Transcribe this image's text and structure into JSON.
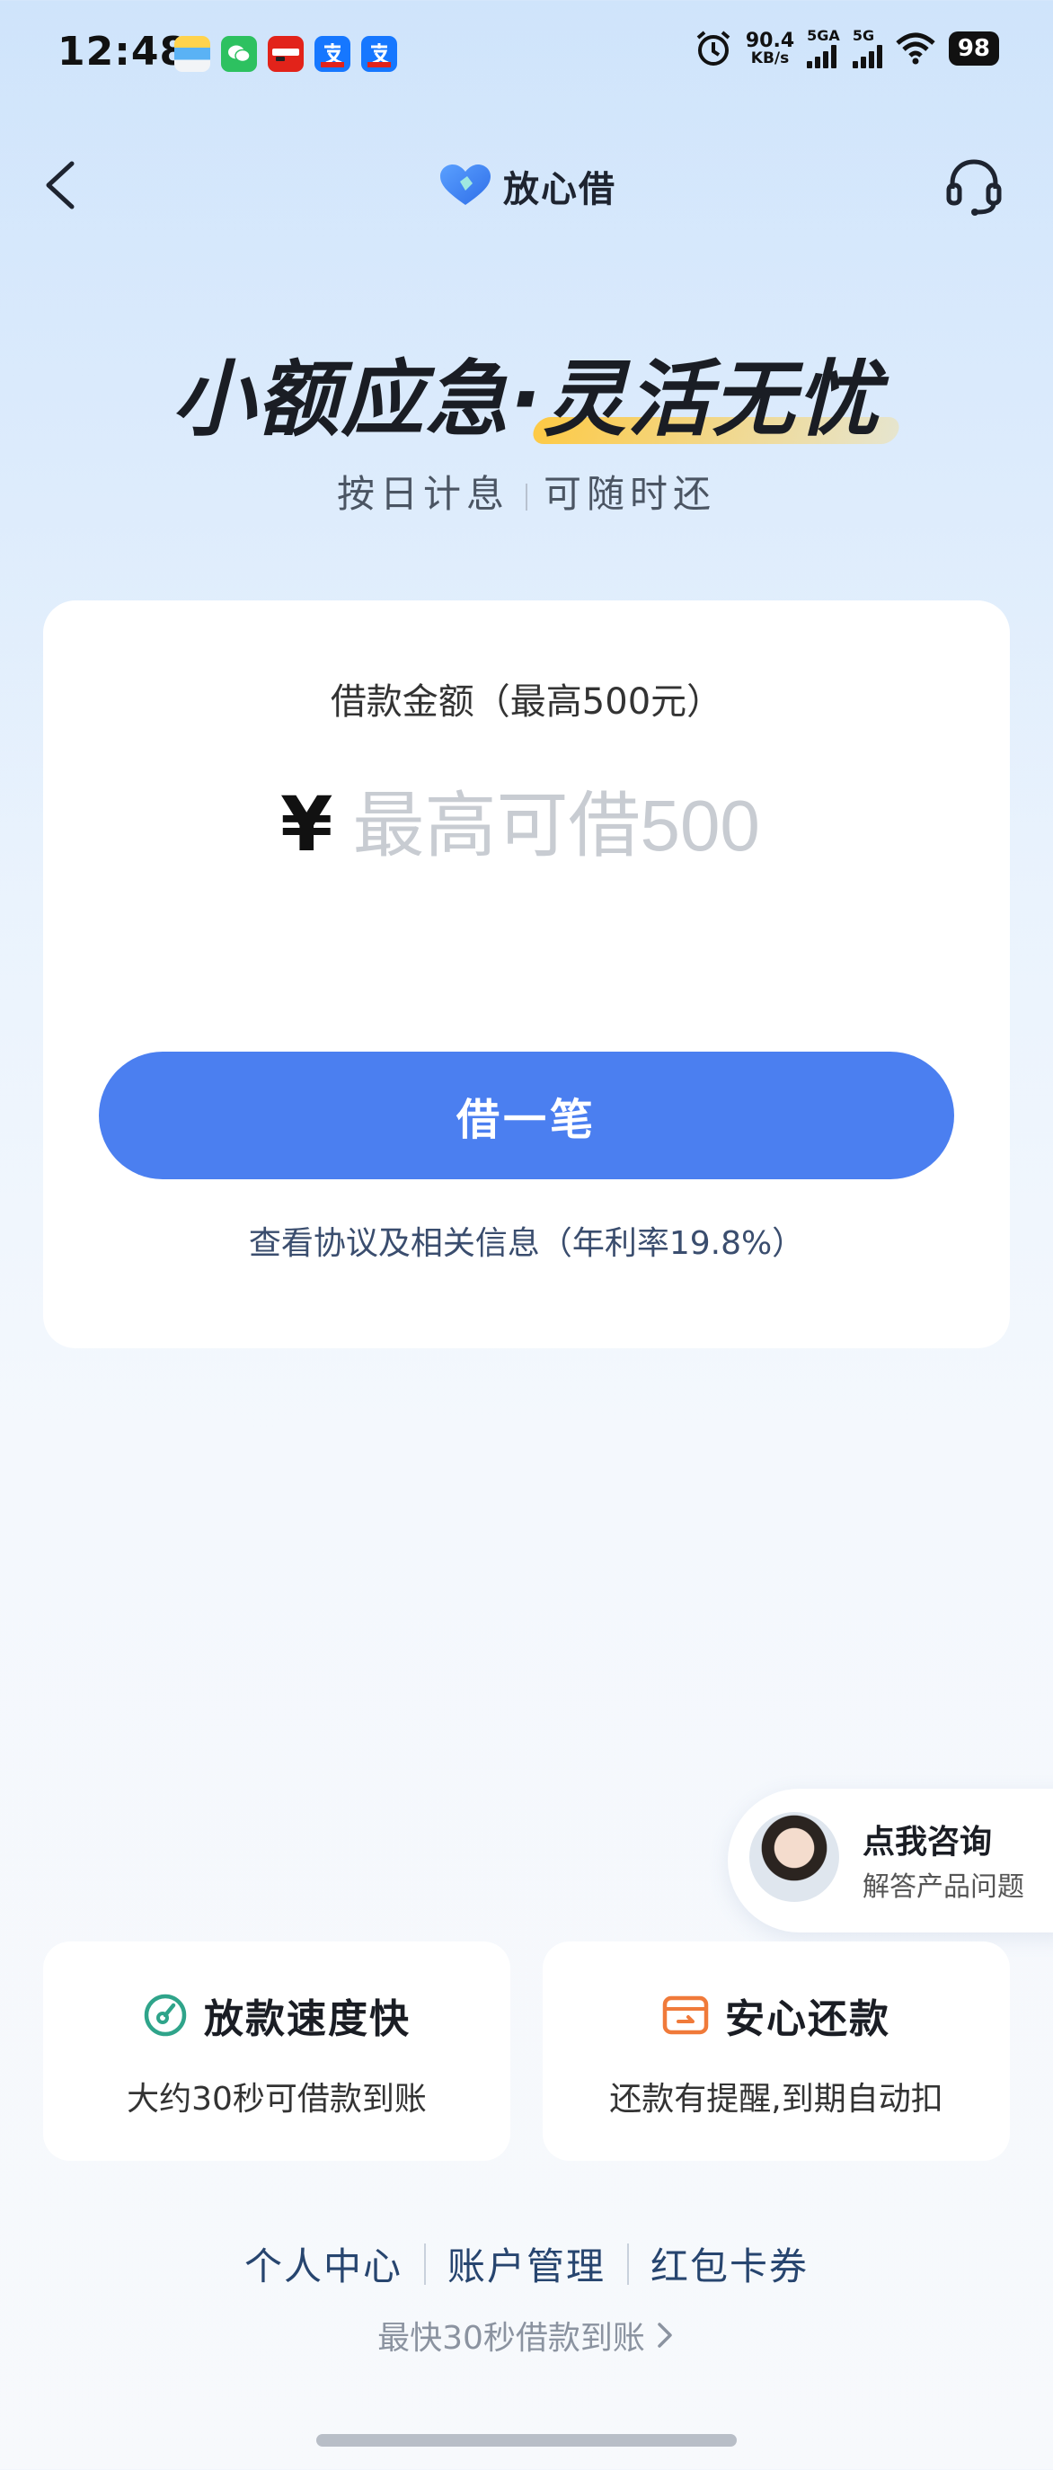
{
  "status_bar": {
    "time": "12:48",
    "net_speed_value": "90.4",
    "net_speed_unit": "KB/s",
    "sim1_label": "5GA",
    "sim2_label": "5G",
    "battery": "98",
    "app_icons": [
      "wallet-icon",
      "wechat-icon",
      "china-unionpay-icon",
      "alipay-icon",
      "alipay-icon"
    ]
  },
  "header": {
    "brand_name": "放心借",
    "back_icon": "chevron-left-icon",
    "service_icon": "headset-icon"
  },
  "hero": {
    "title_part1": "小额应急·",
    "title_part2": "灵活无忧",
    "subtitle_left": "按日计息",
    "subtitle_right": "可随时还"
  },
  "loan_card": {
    "amount_label": "借款金额（最高500元）",
    "currency_symbol": "¥",
    "amount_placeholder": "最高可借500",
    "borrow_button": "借一笔",
    "agreement_text": "查看协议及相关信息（年利率19.8%）"
  },
  "consult": {
    "title": "点我咨询",
    "subtitle": "解答产品问题"
  },
  "features": [
    {
      "icon": "speedometer-icon",
      "title": "放款速度快",
      "desc": "大约30秒可借款到账"
    },
    {
      "icon": "wallet-card-icon",
      "title": "安心还款",
      "desc": "还款有提醒,到期自动扣"
    }
  ],
  "bottom_links": [
    "个人中心",
    "账户管理",
    "红包卡券"
  ],
  "fast_text": "最快30秒借款到账",
  "colors": {
    "primary": "#4b7ff0",
    "speed_icon": "#2fa48a",
    "repay_icon": "#f07a3a"
  }
}
